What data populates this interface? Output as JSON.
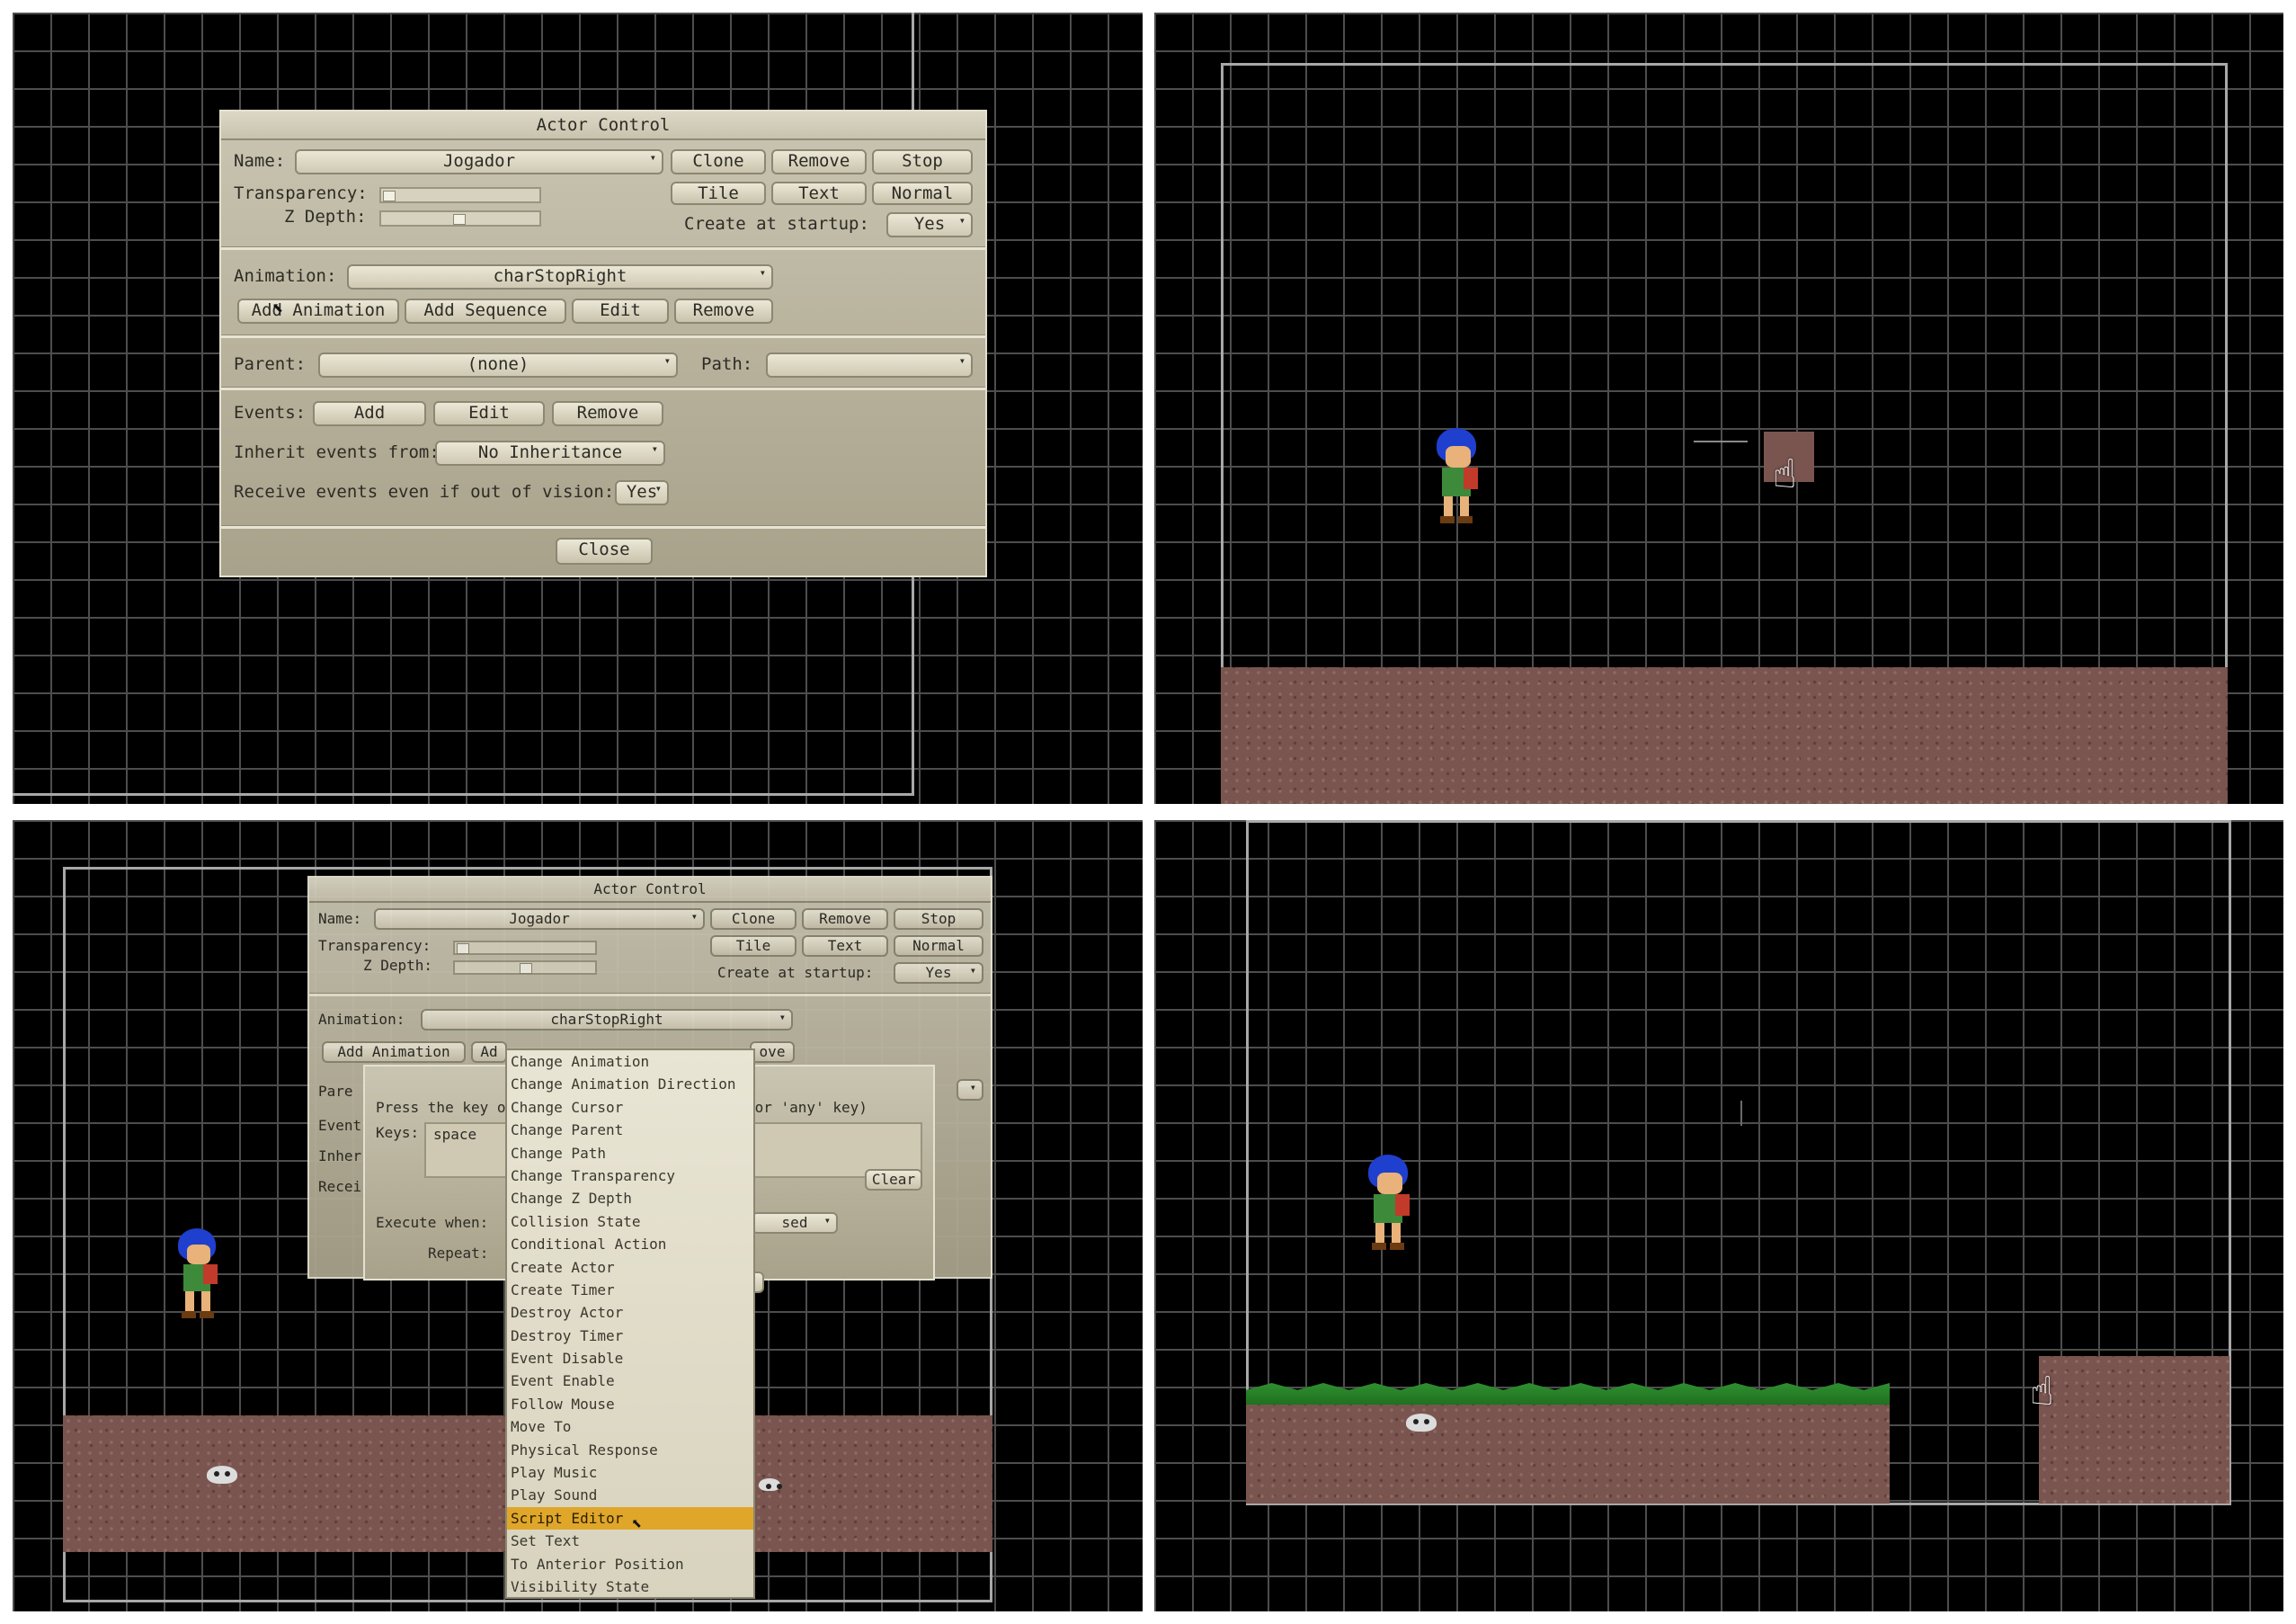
{
  "actor_control": {
    "title": "Actor Control",
    "name_label": "Name:",
    "name_value": "Jogador",
    "clone": "Clone",
    "remove": "Remove",
    "stop": "Stop",
    "transparency_label": "Transparency:",
    "zdepth_label": "Z Depth:",
    "tile": "Tile",
    "text": "Text",
    "normal": "Normal",
    "create_startup_label": "Create at startup:",
    "create_startup_value": "Yes",
    "animation_label": "Animation:",
    "animation_value": "charStopRight",
    "add_animation": "Add Animation",
    "add_sequence": "Add Sequence",
    "edit": "Edit",
    "parent_label": "Parent:",
    "parent_value": "(none)",
    "path_label": "Path:",
    "path_value": "",
    "events_label": "Events:",
    "events_add": "Add",
    "events_edit": "Edit",
    "events_remove": "Remove",
    "inherit_label": "Inherit events from:",
    "inherit_value": "No Inheritance",
    "receive_label": "Receive events even if out of vision:",
    "receive_value": "Yes",
    "close": "Close"
  },
  "key_dialog": {
    "press_text_a": "Press the key o",
    "press_text_b": "for 'any' key)",
    "keys_label": "Keys:",
    "keys_value": "space",
    "clear": "Clear",
    "execute_label": "Execute when:",
    "execute_value_tail": "sed",
    "repeat_label": "Repeat:"
  },
  "partial": {
    "parent": "Pare",
    "events": "Event",
    "inherit": "Inher",
    "receive": "Recei",
    "add_a": "Ad",
    "remove_tail": "ove"
  },
  "action_menu": {
    "items": [
      "Change Animation",
      "Change Animation Direction",
      "Change Cursor",
      "Change Parent",
      "Change Path",
      "Change Transparency",
      "Change Z Depth",
      "Collision State",
      "Conditional Action",
      "Create Actor",
      "Create Timer",
      "Destroy Actor",
      "Destroy Timer",
      "Event Disable",
      "Event Enable",
      "Follow Mouse",
      "Move To",
      "Physical Response",
      "Play Music",
      "Play Sound",
      "Script Editor",
      "Set Text",
      "To Anterior Position",
      "Visibility State"
    ],
    "selected": "Script Editor"
  },
  "icons": {
    "cursor": "pointing-hand-icon",
    "arrow": "arrow-cursor-icon"
  },
  "colors": {
    "grid_bg": "#000000",
    "grid_line": "#4d4d4d",
    "dialog_bg": "#b7b19b",
    "ground": "#7a5550",
    "grass": "#2f8f2f",
    "menu_highlight": "#e0a62a"
  }
}
